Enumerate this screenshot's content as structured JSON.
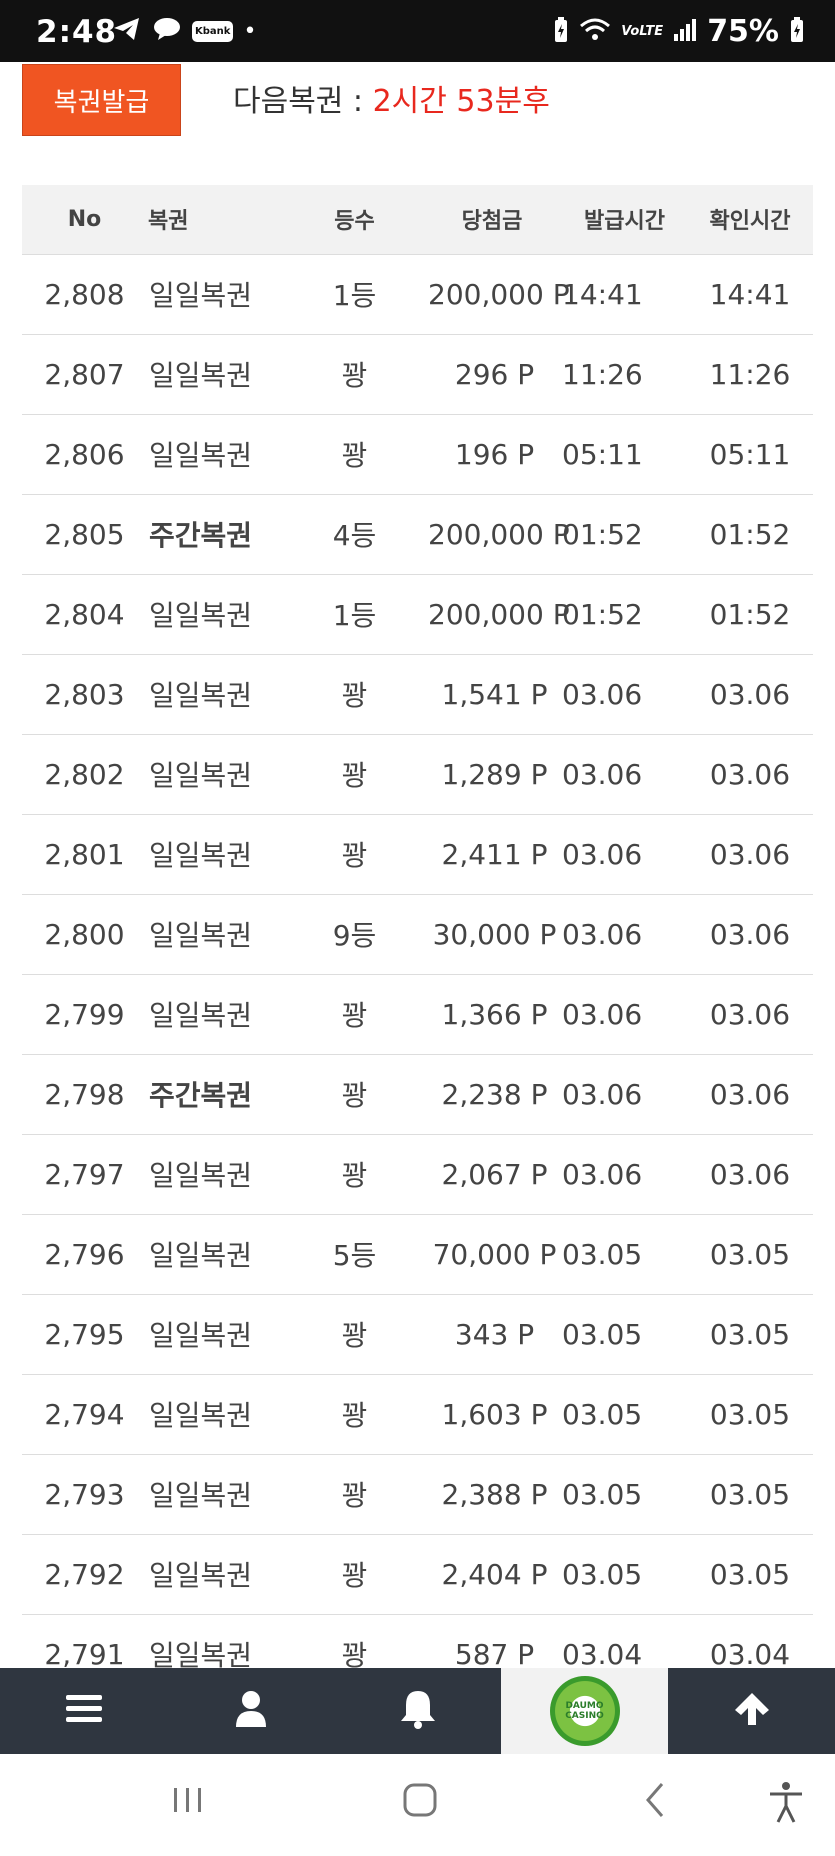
{
  "status_bar": {
    "time": "2:48",
    "icons": [
      "telegram-icon",
      "chat-icon",
      "kbank-icon",
      "dot-icon",
      "battery-saver-icon",
      "wifi-icon",
      "lte-icon",
      "signal-icon",
      "battery-icon"
    ],
    "kbank_label": "Kbank",
    "lte_label": "VoLTE",
    "battery": "75%"
  },
  "header": {
    "issue_button": "복권발급",
    "next_label": "다음복권 : ",
    "next_countdown": "2시간 53분후",
    "countdown_color": "#e8281e",
    "button_color": "#f05522"
  },
  "table": {
    "headers": [
      "No",
      "복권",
      "등수",
      "당첨금",
      "발급시간",
      "확인시간"
    ],
    "rows": [
      {
        "no": "2,808",
        "name": "일일복권",
        "rank": "1등",
        "prize": "200,000 P",
        "issued": "14:41",
        "checked": "14:41",
        "bold": false
      },
      {
        "no": "2,807",
        "name": "일일복권",
        "rank": "꽝",
        "prize": "296 P",
        "issued": "11:26",
        "checked": "11:26",
        "bold": false
      },
      {
        "no": "2,806",
        "name": "일일복권",
        "rank": "꽝",
        "prize": "196 P",
        "issued": "05:11",
        "checked": "05:11",
        "bold": false
      },
      {
        "no": "2,805",
        "name": "주간복권",
        "rank": "4등",
        "prize": "200,000 P",
        "issued": "01:52",
        "checked": "01:52",
        "bold": true
      },
      {
        "no": "2,804",
        "name": "일일복권",
        "rank": "1등",
        "prize": "200,000 P",
        "issued": "01:52",
        "checked": "01:52",
        "bold": false
      },
      {
        "no": "2,803",
        "name": "일일복권",
        "rank": "꽝",
        "prize": "1,541 P",
        "issued": "03.06",
        "checked": "03.06",
        "bold": false
      },
      {
        "no": "2,802",
        "name": "일일복권",
        "rank": "꽝",
        "prize": "1,289 P",
        "issued": "03.06",
        "checked": "03.06",
        "bold": false
      },
      {
        "no": "2,801",
        "name": "일일복권",
        "rank": "꽝",
        "prize": "2,411 P",
        "issued": "03.06",
        "checked": "03.06",
        "bold": false
      },
      {
        "no": "2,800",
        "name": "일일복권",
        "rank": "9등",
        "prize": "30,000 P",
        "issued": "03.06",
        "checked": "03.06",
        "bold": false
      },
      {
        "no": "2,799",
        "name": "일일복권",
        "rank": "꽝",
        "prize": "1,366 P",
        "issued": "03.06",
        "checked": "03.06",
        "bold": false
      },
      {
        "no": "2,798",
        "name": "주간복권",
        "rank": "꽝",
        "prize": "2,238 P",
        "issued": "03.06",
        "checked": "03.06",
        "bold": true
      },
      {
        "no": "2,797",
        "name": "일일복권",
        "rank": "꽝",
        "prize": "2,067 P",
        "issued": "03.06",
        "checked": "03.06",
        "bold": false
      },
      {
        "no": "2,796",
        "name": "일일복권",
        "rank": "5등",
        "prize": "70,000 P",
        "issued": "03.05",
        "checked": "03.05",
        "bold": false
      },
      {
        "no": "2,795",
        "name": "일일복권",
        "rank": "꽝",
        "prize": "343 P",
        "issued": "03.05",
        "checked": "03.05",
        "bold": false
      },
      {
        "no": "2,794",
        "name": "일일복권",
        "rank": "꽝",
        "prize": "1,603 P",
        "issued": "03.05",
        "checked": "03.05",
        "bold": false
      },
      {
        "no": "2,793",
        "name": "일일복권",
        "rank": "꽝",
        "prize": "2,388 P",
        "issued": "03.05",
        "checked": "03.05",
        "bold": false
      },
      {
        "no": "2,792",
        "name": "일일복권",
        "rank": "꽝",
        "prize": "2,404 P",
        "issued": "03.05",
        "checked": "03.05",
        "bold": false
      },
      {
        "no": "2,791",
        "name": "일일복권",
        "rank": "꽝",
        "prize": "587 P",
        "issued": "03.04",
        "checked": "03.04",
        "bold": false
      }
    ]
  },
  "bottom_nav": {
    "items": [
      {
        "name": "menu-icon"
      },
      {
        "name": "user-icon"
      },
      {
        "name": "bell-icon"
      },
      {
        "name": "casino-logo",
        "line1": "DAUMO",
        "line2": "CASINO"
      },
      {
        "name": "arrow-up-icon"
      }
    ],
    "background": "#2f3640"
  },
  "system_nav": {
    "items": [
      "recent-apps-icon",
      "home-icon",
      "back-icon",
      "accessibility-icon"
    ]
  }
}
